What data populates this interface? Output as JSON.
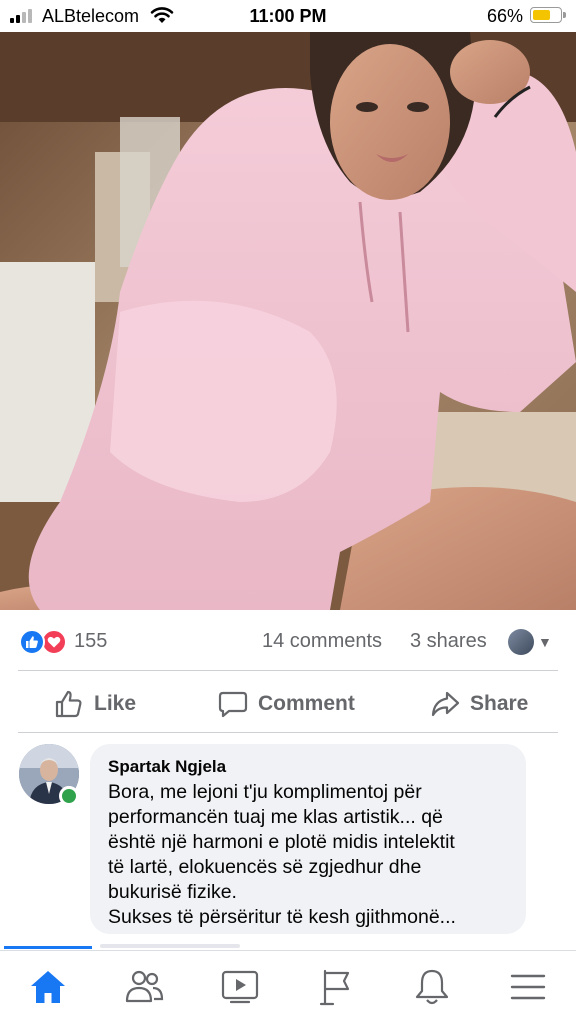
{
  "status_bar": {
    "carrier": "ALBtelecom",
    "time": "11:00 PM",
    "battery_percent": "66%",
    "battery_level": 0.66,
    "signal_bars_filled": 2,
    "signal_bars_total": 4
  },
  "post": {
    "photo": "selfie-photo-pink-hoodie",
    "reactions": {
      "types": [
        "like",
        "love"
      ],
      "count": "155"
    },
    "comments_count": "14 comments",
    "shares_count": "3 shares",
    "actions": {
      "like_label": "Like",
      "comment_label": "Comment",
      "share_label": "Share"
    }
  },
  "comment": {
    "author": "Spartak Ngjela",
    "online": true,
    "lines": [
      "Bora, me lejoni t'ju komplimentoj për",
      "performancën tuaj me klas artistik... që",
      "është një harmoni e plotë midis intelektit",
      "të lartë, elokuencës së zgjedhur dhe",
      "bukurisë fizike.",
      "Sukses të përsëritur të kesh gjithmonë..."
    ]
  },
  "bottom_nav": {
    "items": [
      {
        "name": "home",
        "icon": "home-icon",
        "active": true
      },
      {
        "name": "friends",
        "icon": "friends-icon",
        "active": false
      },
      {
        "name": "watch",
        "icon": "watch-icon",
        "active": false
      },
      {
        "name": "pages",
        "icon": "flag-icon",
        "active": false
      },
      {
        "name": "notifications",
        "icon": "bell-icon",
        "active": false
      },
      {
        "name": "menu",
        "icon": "hamburger-icon",
        "active": false
      }
    ]
  },
  "colors": {
    "accent": "#1877f2",
    "love": "#f33e58",
    "secondary_text": "#65676b",
    "online": "#31a24c",
    "bubble": "#f0f2f5"
  }
}
